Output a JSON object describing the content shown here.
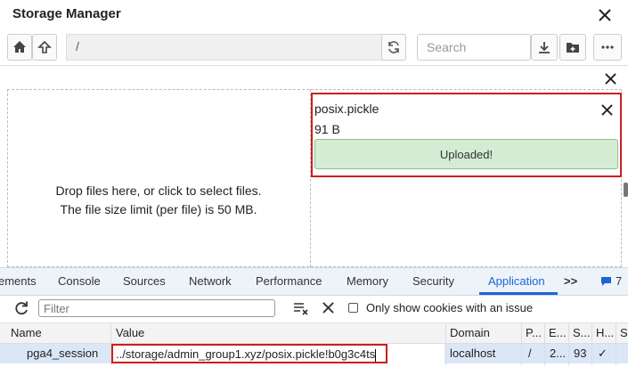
{
  "dialog": {
    "title": "Storage Manager",
    "path": "/",
    "search_placeholder": "Search",
    "drop_line1": "Drop files here, or click to select files.",
    "drop_line2": "The file size limit (per file) is 50 MB.",
    "file": {
      "name": "posix.pickle",
      "size": "91 B",
      "status": "Uploaded!"
    },
    "colors": {
      "highlight": "#cc1f1f",
      "success_bg": "#d4ecd4"
    }
  },
  "devtools": {
    "tabs": [
      "ements",
      "Console",
      "Sources",
      "Network",
      "Performance",
      "Memory",
      "Security",
      "Application"
    ],
    "active_tab": "Application",
    "more_tabs": ">>",
    "issues_count": "7",
    "filter_placeholder": "Filter",
    "only_issue_label": "Only show cookies with an issue",
    "columns": [
      "Name",
      "Value",
      "Domain",
      "P...",
      "E...",
      "S...",
      "H...",
      "S"
    ],
    "row": {
      "name": "pga4_session",
      "value": "../storage/admin_group1.xyz/posix.pickle!b0g3c4ts",
      "domain": "localhost",
      "path": "/",
      "expires": "2...",
      "size": "93",
      "httponly": "✓"
    }
  }
}
